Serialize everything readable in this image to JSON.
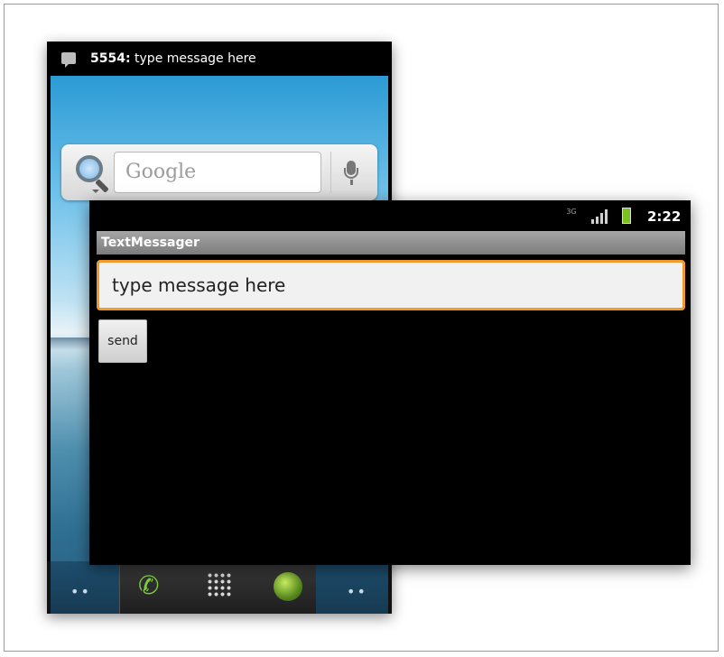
{
  "notification": {
    "sender": "5554:",
    "text": " type message here"
  },
  "home": {
    "search_placeholder": "Google",
    "dock": {
      "left_dots": "••",
      "right_dots": "••",
      "phone_glyph": "✆"
    }
  },
  "status_bar": {
    "network": "3G",
    "time": "2:22"
  },
  "app": {
    "title": "TextMessager",
    "message_value": "type message here",
    "send_label": "send"
  },
  "colors": {
    "focus_border": "#f2992e",
    "battery": "#7cc21f"
  }
}
